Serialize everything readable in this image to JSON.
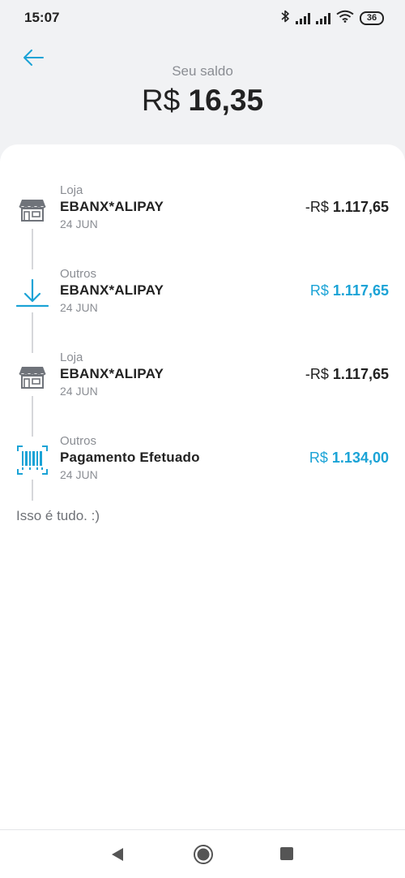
{
  "status_bar": {
    "time": "15:07",
    "battery": "36"
  },
  "header": {
    "balance_label": "Seu saldo",
    "balance_currency": "R$",
    "balance_value": "16,35"
  },
  "transactions": [
    {
      "category": "Loja",
      "name": "EBANX*ALIPAY",
      "date": "24 JUN",
      "amount_prefix": "-R$",
      "amount_value": "1.117,65",
      "type": "debit",
      "icon": "store-icon"
    },
    {
      "category": "Outros",
      "name": "EBANX*ALIPAY",
      "date": "24 JUN",
      "amount_prefix": "R$",
      "amount_value": "1.117,65",
      "type": "credit",
      "icon": "download-arrow-icon"
    },
    {
      "category": "Loja",
      "name": "EBANX*ALIPAY",
      "date": "24 JUN",
      "amount_prefix": "-R$",
      "amount_value": "1.117,65",
      "type": "debit",
      "icon": "store-icon"
    },
    {
      "category": "Outros",
      "name": "Pagamento Efetuado",
      "date": "24 JUN",
      "amount_prefix": "R$",
      "amount_value": "1.134,00",
      "type": "credit",
      "icon": "barcode-icon"
    }
  ],
  "end_message": "Isso é tudo. :)",
  "colors": {
    "accent": "#1ba3d6",
    "background": "#f1f2f4",
    "text": "#222222",
    "muted": "#8a8d93"
  }
}
